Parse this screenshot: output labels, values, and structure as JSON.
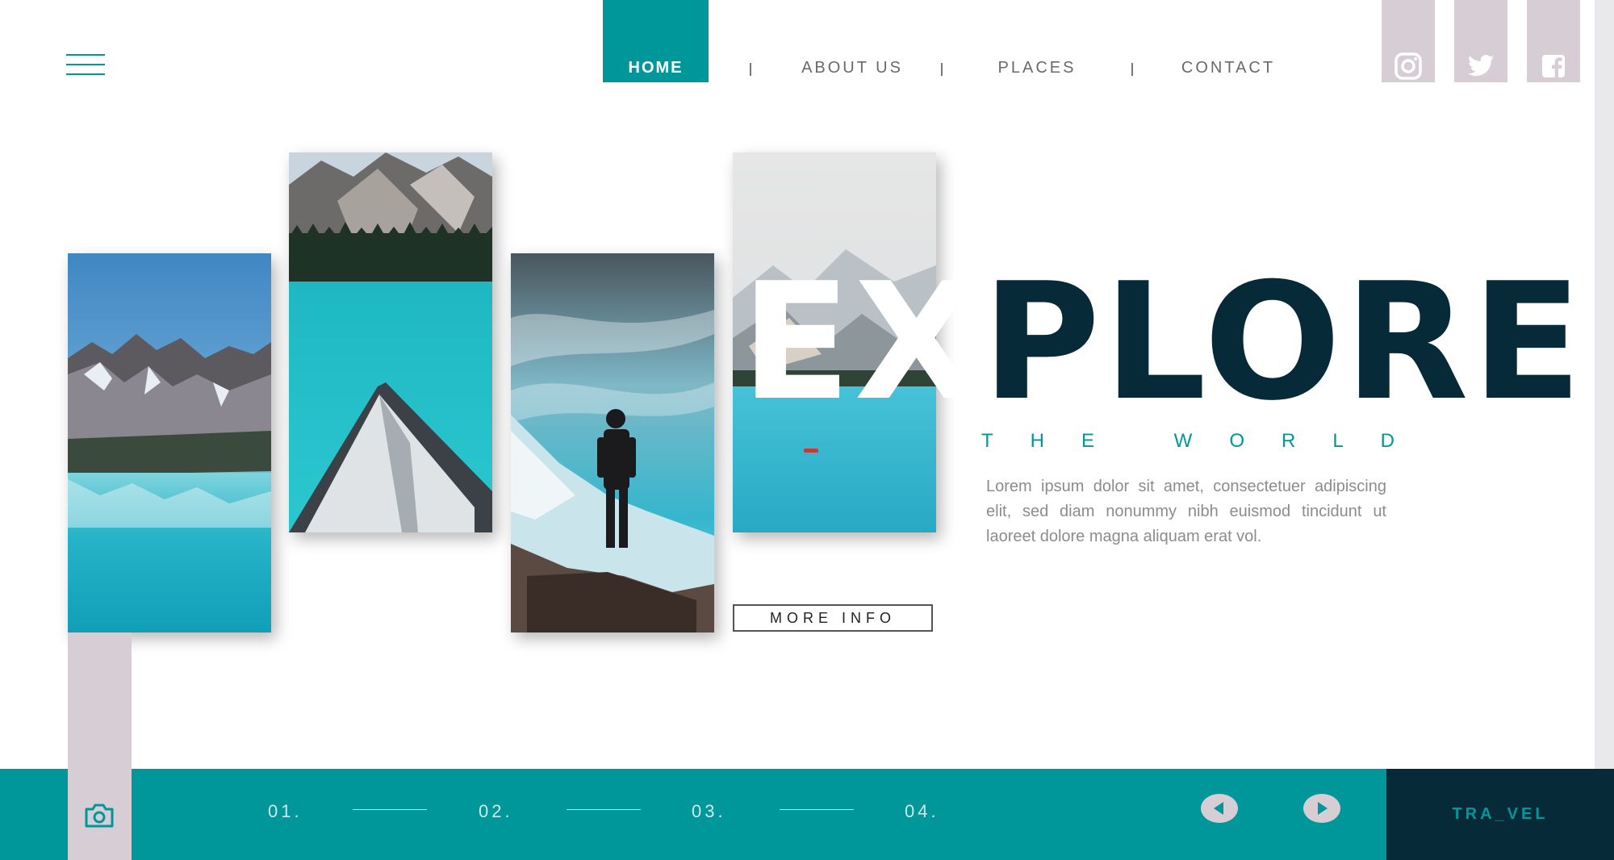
{
  "nav": {
    "items": [
      {
        "label": "HOME",
        "active": true
      },
      {
        "label": "ABOUT US",
        "active": false
      },
      {
        "label": "PLACES",
        "active": false
      },
      {
        "label": "CONTACT",
        "active": false
      }
    ],
    "separator": "I"
  },
  "social": {
    "items": [
      "instagram-icon",
      "twitter-icon",
      "facebook-icon"
    ]
  },
  "hero": {
    "title_ghost": "EX",
    "title_rest": "PLORE",
    "subtitle": "THE WORLD",
    "body": "Lorem ipsum dolor sit amet, consectetuer adipiscing elit, sed diam nonummy nibh euismod tincidunt ut laoreet dolore magna aliquam erat vol.",
    "cta_label": "MORE INFO"
  },
  "footer": {
    "steps": [
      "01.",
      "02.",
      "03.",
      "04."
    ],
    "brand": "TRA_VEL"
  },
  "colors": {
    "accent": "#00979a",
    "dark": "#062a38",
    "muted_lilac": "#d6cdd5"
  }
}
